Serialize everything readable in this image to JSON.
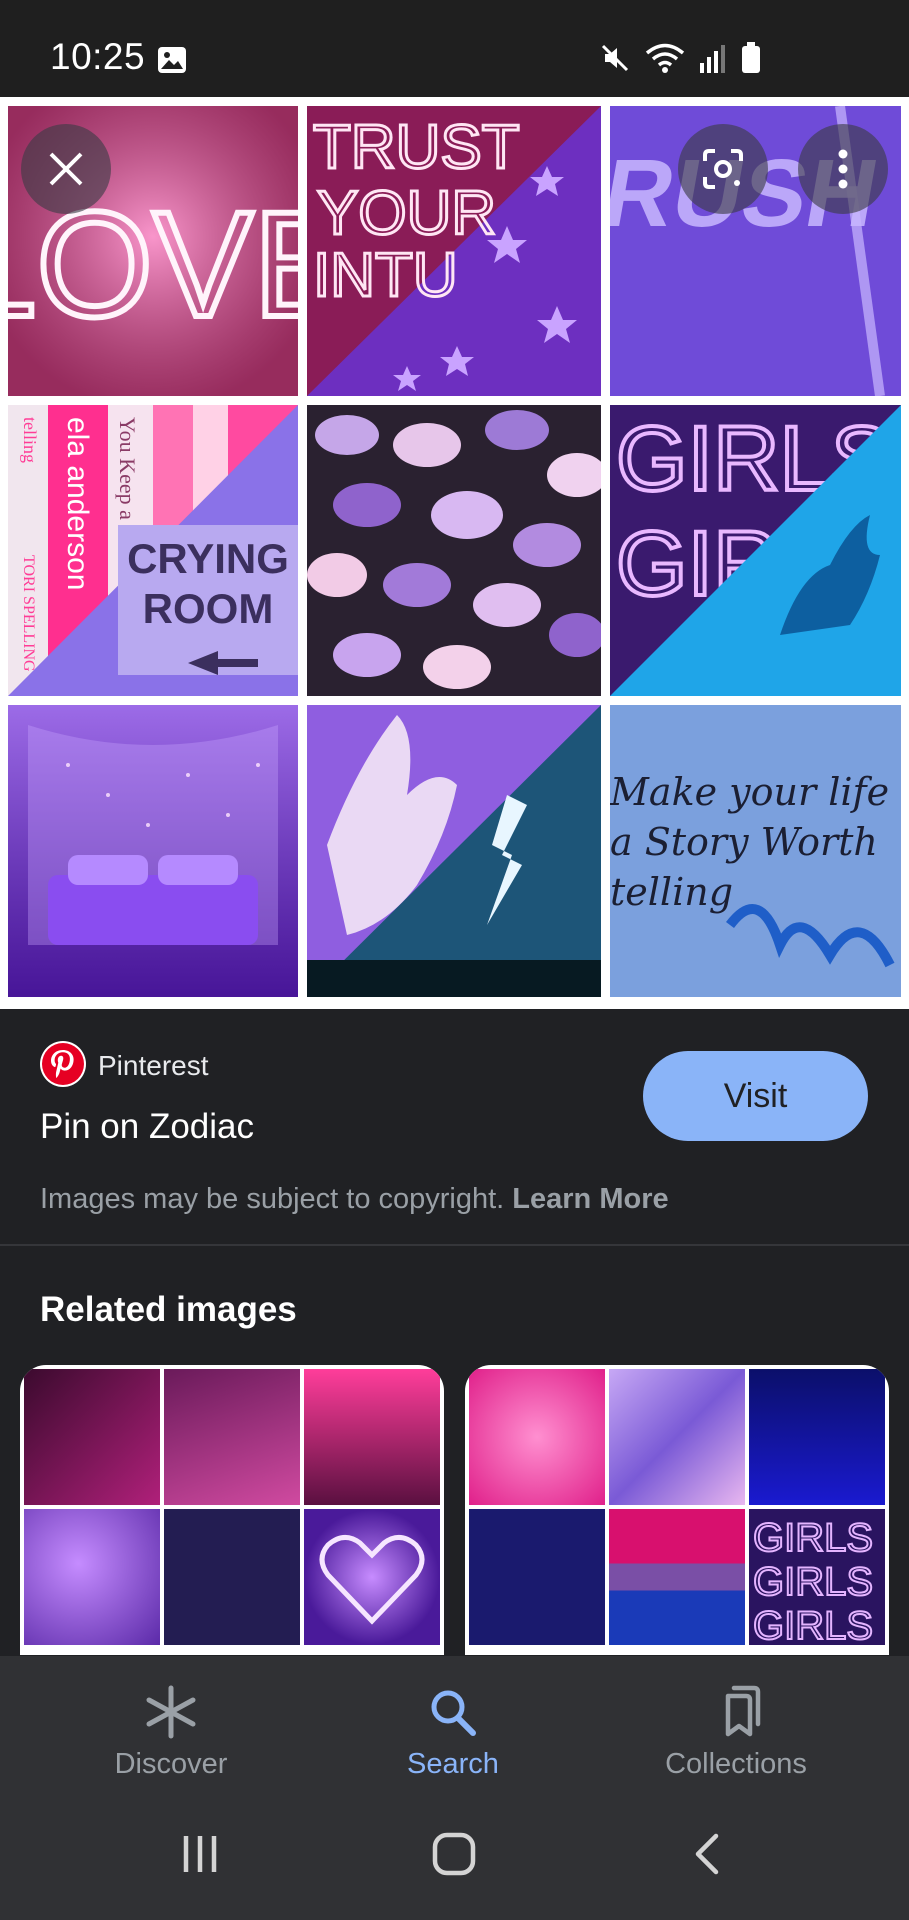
{
  "status_bar": {
    "time": "10:25",
    "icons": [
      "image-icon",
      "mute-icon",
      "wifi-icon",
      "signal-icon",
      "battery-icon"
    ]
  },
  "viewer": {
    "close_icon": "close-icon",
    "lens_icon": "lens-icon",
    "more_icon": "more-vert-icon",
    "collage_text": {
      "tile1": "LOVE",
      "tile2": [
        "TRUST",
        "YOUR",
        "INTU"
      ],
      "tile3": "RUSH",
      "tile4_spines": [
        "ela anderson",
        "You Keep a Sec",
        "telling",
        "TORI SPELLING"
      ],
      "tile4_sign": [
        "CRYING",
        "ROOM"
      ],
      "tile6": [
        "GIRLS",
        "GIR"
      ],
      "tile9": [
        "Make your life",
        "a Story Worth",
        "telling"
      ]
    }
  },
  "result": {
    "source": "Pinterest",
    "title": "Pin on Zodiac",
    "visit_label": "Visit",
    "copyright_text": "Images may be subject to copyright.",
    "learn_more": "Learn More"
  },
  "related": {
    "heading": "Related images",
    "card2_text": "GIRLS"
  },
  "bottom_nav": {
    "items": [
      {
        "label": "Discover",
        "icon": "asterisk-icon"
      },
      {
        "label": "Search",
        "icon": "search-icon"
      },
      {
        "label": "Collections",
        "icon": "collections-icon"
      }
    ],
    "active": "Search"
  },
  "colors": {
    "accent": "#8ab4f8",
    "background": "#202124",
    "nav_background": "#303134",
    "pinterest_red": "#e60023"
  }
}
